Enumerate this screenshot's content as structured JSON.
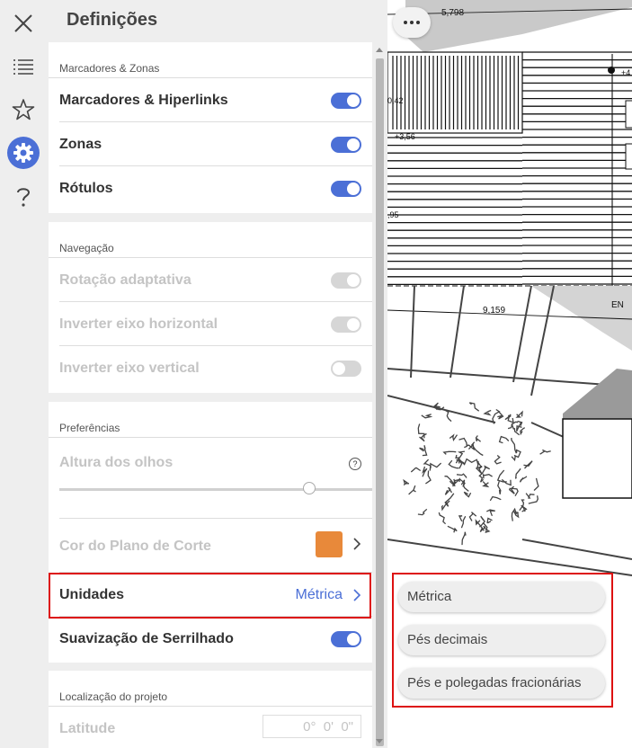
{
  "panel": {
    "title": "Definições"
  },
  "sections": {
    "bookmarks": {
      "header": "Marcadores & Zonas",
      "rows": [
        {
          "label": "Marcadores & Hiperlinks",
          "state": "on"
        },
        {
          "label": "Zonas",
          "state": "on"
        },
        {
          "label": "Rótulos",
          "state": "on"
        }
      ]
    },
    "navigation": {
      "header": "Navegação",
      "rows": [
        {
          "label": "Rotação adaptativa",
          "state": "disabled-on"
        },
        {
          "label": "Inverter eixo horizontal",
          "state": "disabled-on"
        },
        {
          "label": "Inverter eixo vertical",
          "state": "disabled-off"
        }
      ]
    },
    "preferences": {
      "header": "Preferências",
      "eye_height_label": "Altura dos olhos",
      "eye_height_help": "?",
      "eye_height_value": 0.8,
      "cut_plane_label": "Cor do Plano de Corte",
      "cut_plane_color": "#e8893a",
      "units_label": "Unidades",
      "units_value": "Métrica",
      "antialias_label": "Suavização de Serrilhado",
      "antialias_state": "on"
    },
    "location": {
      "header": "Localização do projeto",
      "latitude_label": "Latitude",
      "latitude_value": "0°  0'  0\""
    }
  },
  "units_menu": {
    "options": [
      "Métrica",
      "Pés decimais",
      "Pés e polegadas fracionárias"
    ]
  },
  "drawing": {
    "labels": [
      "5,798",
      "+4",
      "0,42",
      "+3,56",
      ",95",
      "9,159",
      "EN"
    ]
  },
  "colors": {
    "accent": "#4b6fd6",
    "highlight": "#dd1111",
    "cut_plane": "#e8893a"
  }
}
